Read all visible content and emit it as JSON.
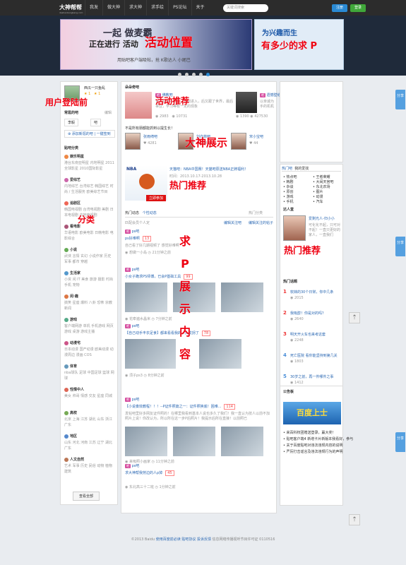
{
  "topbar": {
    "logo": "大神帮帮",
    "logo_sub": "dashenbangbang.com",
    "badge": "beta",
    "nav": [
      "我发",
      "做大神",
      "求大神",
      "求手绘",
      "PS论坛",
      "关于"
    ],
    "search_placeholder": "关键词搜索",
    "register": "注册",
    "login": "登录"
  },
  "banner": {
    "main_line1": "一起 做麦霸",
    "main_line2": "正在进行 活动",
    "main_line3": "用贴吧客户端吸帖，抢 K歌达人 小尾巴",
    "side_title": "为兴趣而生",
    "annotation_main": "活动位置",
    "annotation_side": "有多少的求 P"
  },
  "left": {
    "username": "西瓜一只鱼乱",
    "stats": [
      "1",
      "1"
    ],
    "annotation": "用户登陆前",
    "used_bars_title": "常逛的吧",
    "manage": "编辑",
    "bar1": "李毅",
    "bar2": "吧",
    "add_bar": "添加新逛的吧",
    "one_click": "一键签到",
    "category_title": "贴吧分类",
    "categories": [
      {
        "name": "娱乐明星",
        "items": "港台东南亚明星 内地明星 2011全球影星 2010国际影星",
        "color": "#e84"
      },
      {
        "name": "爱综艺",
        "items": "内地综艺 台湾综艺 韩国综艺 时尚 / 生活服务 欧美综艺节目",
        "color": "#c6a"
      },
      {
        "name": "追剧区",
        "items": "韩国电视剧 台湾电视剧 美剧 日本电视剧 内地电视剧",
        "color": "#e65"
      },
      {
        "name": "看电影",
        "items": "华语电影 欧美电影 日韩电影 电影综合",
        "color": "#a57"
      },
      {
        "name": "小说",
        "items": "武侠 言情 玄幻 小说作家 历史 军事 都市 穿越",
        "color": "#6a5"
      },
      {
        "name": "生活家",
        "items": "小资 闲 IT 美食 旅游 摄影 时尚 手机 宠物",
        "color": "#59c"
      },
      {
        "name": "闲·趣",
        "items": "搞笑 星座 爆料 八卦 恐怖 宗教 新闻",
        "color": "#d74"
      },
      {
        "name": "游戏",
        "items": "客户端网游 单机 手机游戏 网页游戏 桌游 游戏主播",
        "color": "#5a8"
      },
      {
        "name": "动漫宅",
        "items": "日本动漫 国产动漫 欧美动漫 动漫周边 漫画 COS",
        "color": "#c58"
      },
      {
        "name": "体育",
        "items": "nba球队 足球 中国足球 篮球 网球",
        "color": "#69b"
      },
      {
        "name": "性情中人",
        "items": "美女 帅哥 情感 交友 星座 同城",
        "color": "#d65"
      },
      {
        "name": "高校",
        "items": "北京 上海 江苏 湖北 山东 浙江 广东",
        "color": "#7a5"
      },
      {
        "name": "地区",
        "items": "山东 河北 河南 江苏 辽宁 湖北 广东",
        "color": "#58c"
      },
      {
        "name": "人文自然",
        "items": "艺术 军事 历史 民俗 动物 植物 建筑",
        "color": "#b75"
      }
    ],
    "view_all": "查看全部"
  },
  "mid": {
    "header_title": "朵朵奇吧",
    "annotation_activity": "活动推荐",
    "promo1_title": "佛教吧",
    "promo1_desc": "曾入驻某人学生，从刚进入，后又跟了世界，最后事业，学习等有一定的现象",
    "promo1_count1": "2983",
    "promo1_count2": "10731",
    "promo2_title": "遗憾壁纸吧",
    "promo2_desc": "以亲诚为手的机机壁纸大家一起来生活中去",
    "promo2_count1": "1390",
    "promo2_count2": "427530",
    "slogan": "不是所有朋都能抓到以提生长！",
    "annotation_gods": "大神展示",
    "gods": [
      {
        "name": "张雨绮吧",
        "count": "4281"
      },
      {
        "name": "刘亦菲吧",
        "count": "76844"
      },
      {
        "name": "宋小宝吧",
        "count": "44"
      }
    ],
    "nba_title": "天猫吧：NBA中国赛！天猫吧原送NBA正牌福利！",
    "nba_sub": "时间：2013.10.17-2013.10.28",
    "nba_cta": "立即参加",
    "annotation_hot": "热门推荐",
    "feed_tabs": [
      "热门动态",
      "个性动态"
    ],
    "feed_right": "热门分类",
    "feed_intro": "匹配会员个人定",
    "feed_edit": "编辑关注吧",
    "feed_edit2": "编辑关注的帖子",
    "annotation_feed": "求P展示内容",
    "posts": [
      {
        "bar": "ps吧",
        "title": "ps好难啊",
        "reply": "13",
        "body": "自己看了好几期视频了 感觉好难啊",
        "meta": "想做一小岛"
      },
      {
        "bar": "ps吧",
        "title": "小女子跪求PS师傅，已会P基础工具",
        "reply": "99",
        "body": "",
        "meta": "花牵遍水晶米"
      },
      {
        "bar": "ps吧",
        "title": "【自己动手丰衣足食】都来看看我的...头发拐了",
        "reply": "78",
        "body": "",
        "meta": "须子ps3"
      },
      {
        "bar": "ps吧",
        "title": "【小说奏效教程！！！--P证件照篇之一：证件照换底！困难...",
        "reply": "114",
        "body": "发帖吧里好多网友证件照的！在哪里我看到基本人说也多久了我们！我一直认为技人以前不加照片上说！你改认为，所以所在这一步P后照片！我提示后所在直接！以前照已",
        "meta": "来吸照小画家"
      },
      {
        "bar": "ps吧",
        "title": "求大神帮我劳边的人p掉",
        "reply": "45",
        "body": "",
        "meta": "东北高三十二班"
      }
    ],
    "time_labels": [
      "21分钟之前",
      "7分钟之前",
      "8分钟之前",
      "11分钟之前",
      "1分钟之前"
    ]
  },
  "right": {
    "top_title": "达人堂",
    "expert_name": "爱剩光人-归小小",
    "expert_desc": "可化化不起，只可对不起！一直只更好的家人，一直我们",
    "hot_recommend": "热门推荐",
    "tabs": [
      "热门吧",
      "我的爱找"
    ],
    "bars": [
      "热点吧",
      "王者荣耀",
      "韩剧",
      "大闹天宫吧",
      "杂谈",
      "东北农场",
      "原创",
      "图片",
      "游戏",
      "动漫",
      "手机",
      "汽车"
    ],
    "topics_title": "热门话题",
    "topics": [
      {
        "rank": "1",
        "text": "软妹的30个日常，你中几条",
        "count": "2015"
      },
      {
        "rank": "2",
        "text": "我吸醇！你是对的吗？",
        "count": "2640"
      },
      {
        "rank": "3",
        "text": "明天开火车也来考这套",
        "count": "2248"
      },
      {
        "rank": "4",
        "text": "死亡医院 看你能坚持到第几关",
        "count": "1803"
      },
      {
        "rank": "5",
        "text": "30岁之前，再一件哪件之事",
        "count": "1412"
      }
    ],
    "notice_title": "公告板",
    "notice_banner": "百度上士",
    "notices": [
      "来百科权团赠送登录，赢大奖！",
      "贴吧客户端4 新增卡片新版本我看好，参与",
      "关于百度贴吧对违法违规内容的说明",
      "严厉打击谣言及违法违规行为的声明"
    ]
  },
  "side": {
    "share": "分享"
  },
  "footer": {
    "copyright": "©2013 Baidu",
    "links": [
      "使用百度前必读",
      "贴吧协议",
      "投诉反馈",
      "信息网络传播视听节目许可证 0110516"
    ]
  }
}
